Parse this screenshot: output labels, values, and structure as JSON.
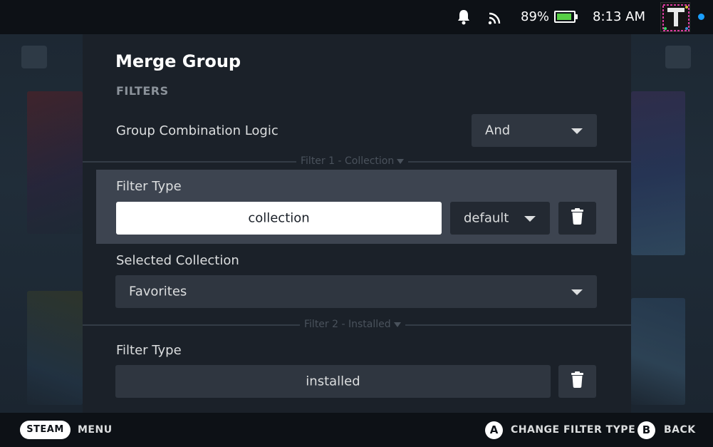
{
  "status_bar": {
    "battery_percent": "89%",
    "battery_level": 0.89,
    "time": "8:13 AM",
    "icons": [
      "bell-icon",
      "wifi-icon",
      "battery-icon"
    ],
    "accent_dot_color": "#1a9fff"
  },
  "dialog": {
    "title": "Merge Group",
    "section": "FILTERS",
    "combination_logic": {
      "label": "Group Combination Logic",
      "value": "And"
    },
    "filters": [
      {
        "header": "Filter 1 - Collection",
        "type_label": "Filter Type",
        "type_value": "collection",
        "mode_value": "default",
        "param_label": "Selected Collection",
        "param_value": "Favorites"
      },
      {
        "header": "Filter 2 - Installed",
        "type_label": "Filter Type",
        "type_value": "installed"
      }
    ]
  },
  "bottom_bar": {
    "steam_label": "STEAM",
    "menu_label": "MENU",
    "a_button": "A",
    "a_action": "CHANGE FILTER TYPE",
    "b_button": "B",
    "b_action": "BACK"
  },
  "colors": {
    "panel_bg": "#1b2129",
    "focus_row_bg": "#3d4450",
    "control_bg": "#2f3640",
    "battery_fill": "#58d046"
  }
}
